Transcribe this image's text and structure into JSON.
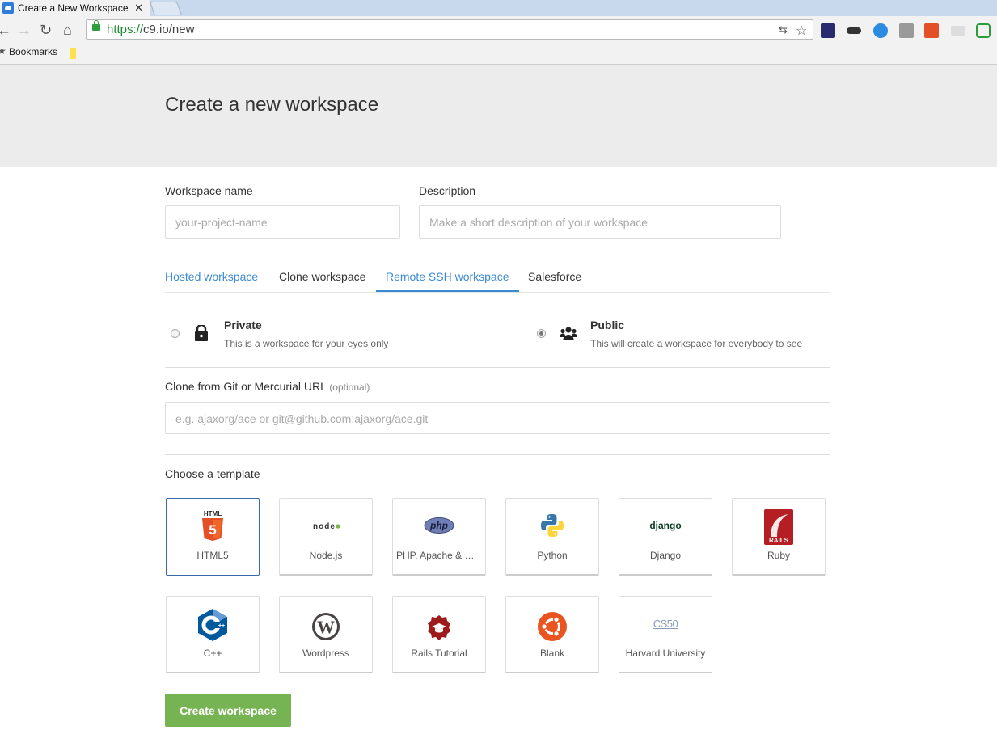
{
  "browser": {
    "tab_title": "Create a New Workspace",
    "tab_close": "✕",
    "url_scheme": "https://",
    "url_rest": "c9.io/new",
    "bookmarks_label": "Bookmarks"
  },
  "page": {
    "title": "Create a new workspace"
  },
  "form": {
    "name_label": "Workspace name",
    "name_placeholder": "your-project-name",
    "desc_label": "Description",
    "desc_placeholder": "Make a short description of your workspace"
  },
  "workspace_tabs": [
    {
      "label": "Hosted workspace"
    },
    {
      "label": "Clone workspace"
    },
    {
      "label": "Remote SSH workspace"
    },
    {
      "label": "Salesforce"
    }
  ],
  "visibility": {
    "private": {
      "title": "Private",
      "desc": "This is a workspace for your eyes only",
      "icon": "lock-icon"
    },
    "public": {
      "title": "Public",
      "desc": "This will create a workspace for everybody to see",
      "icon": "users-icon",
      "selected": true
    }
  },
  "clone": {
    "label": "Clone from Git or Mercurial URL",
    "optional": "(optional)",
    "placeholder": "e.g. ajaxorg/ace or git@github.com:ajaxorg/ace.git"
  },
  "templates": {
    "heading": "Choose a template",
    "items": [
      {
        "name": "HTML5",
        "logo_text": "HTML",
        "selected": true
      },
      {
        "name": "Node.js",
        "logo_text": "node"
      },
      {
        "name": "PHP, Apache & MySQL",
        "logo_text": "php"
      },
      {
        "name": "Python"
      },
      {
        "name": "Django",
        "logo_text": "django"
      },
      {
        "name": "Ruby",
        "logo_text": "RAILS"
      },
      {
        "name": "C++"
      },
      {
        "name": "Wordpress"
      },
      {
        "name": "Rails Tutorial"
      },
      {
        "name": "Blank"
      },
      {
        "name": "Harvard University",
        "logo_text": "CS50"
      }
    ]
  },
  "actions": {
    "create_label": "Create workspace"
  },
  "colors": {
    "accent": "#3a8ad4",
    "create_button": "#76b453"
  }
}
